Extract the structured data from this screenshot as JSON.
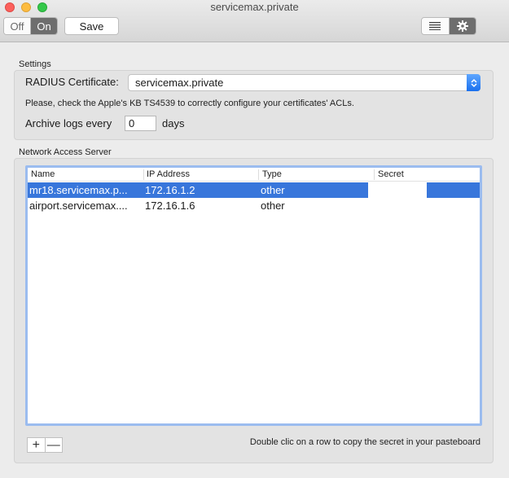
{
  "window": {
    "title": "servicemax.private"
  },
  "toolbar": {
    "off_label": "Off",
    "on_label": "On",
    "save_label": "Save",
    "list_view_icon": "list-icon",
    "settings_icon": "gear-icon",
    "on_active": true
  },
  "settings": {
    "section_title": "Settings",
    "radius_label": "RADIUS Certificate:",
    "radius_value": "servicemax.private",
    "kb_note": "Please, check the Apple's KB TS4539 to correctly configure your certificates' ACLs.",
    "archive_label": "Archive logs every",
    "archive_value": "0",
    "days_label": "days"
  },
  "nas": {
    "section_title": "Network Access Server",
    "columns": [
      "Name",
      "IP Address",
      "Type",
      "Secret"
    ],
    "rows": [
      {
        "name": "mr18.servicemax.p...",
        "ip": "172.16.1.2",
        "type": "other",
        "secret": "",
        "selected": true
      },
      {
        "name": "airport.servicemax....",
        "ip": "172.16.1.6",
        "type": "other",
        "secret": "",
        "selected": false
      }
    ],
    "add_label": "+",
    "remove_label": "—",
    "hint": "Double clic on a row to copy the secret in your pasteboard"
  },
  "colors": {
    "selection": "#3876db",
    "accent": "#1a70ee",
    "close": "#fc605c",
    "minimize": "#fdbc40",
    "maximize": "#34c84a"
  }
}
